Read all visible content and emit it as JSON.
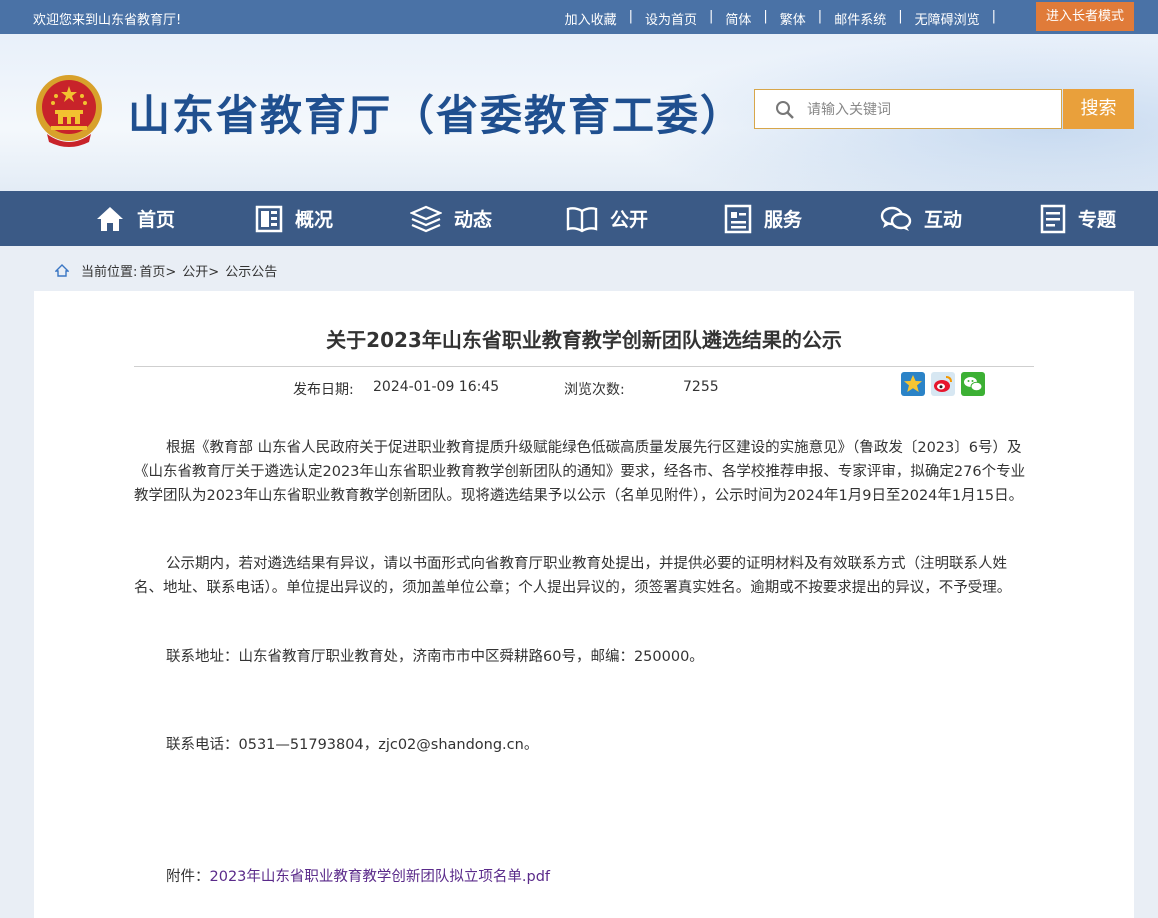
{
  "topbar": {
    "welcome": "欢迎您来到山东省教育厅!",
    "links": [
      "加入收藏",
      "设为首页",
      "简体",
      "繁体",
      "邮件系统",
      "无障碍浏览"
    ],
    "separator": "|",
    "elder_mode": "进入长者模式"
  },
  "header": {
    "site_title": "山东省教育厅（省委教育工委）",
    "search_placeholder": "请输入关键词",
    "search_button": "搜索"
  },
  "nav": {
    "items": [
      "首页",
      "概况",
      "动态",
      "公开",
      "服务",
      "互动",
      "专题"
    ]
  },
  "breadcrumb": {
    "prefix": "当前位置:",
    "items": [
      "首页>",
      "公开>",
      "公示公告"
    ]
  },
  "article": {
    "title": "关于2023年山东省职业教育教学创新团队遴选结果的公示",
    "date_label": "发布日期:",
    "date": "2024-01-09 16:45",
    "views_label": "浏览次数:",
    "views": "7255",
    "para1": "根据《教育部 山东省人民政府关于促进职业教育提质升级赋能绿色低碳高质量发展先行区建设的实施意见》（鲁政发〔2023〕6号）及《山东省教育厅关于遴选认定2023年山东省职业教育教学创新团队的通知》要求，经各市、各学校推荐申报、专家评审，拟确定276个专业教学团队为2023年山东省职业教育教学创新团队。现将遴选结果予以公示（名单见附件），公示时间为2024年1月9日至2024年1月15日。",
    "para2": "公示期内，若对遴选结果有异议，请以书面形式向省教育厅职业教育处提出，并提供必要的证明材料及有效联系方式（注明联系人姓名、地址、联系电话）。单位提出异议的，须加盖单位公章；个人提出异议的，须签署真实姓名。逾期或不按要求提出的异议，不予受理。",
    "address": "联系地址：山东省教育厅职业教育处，济南市市中区舜耕路60号，邮编：250000。",
    "phone": "联系电话：0531—51793804，zjc02@shandong.cn。",
    "attachment_label": "附件：",
    "attachment_link": "2023年山东省职业教育教学创新团队拟立项名单.pdf"
  },
  "colors": {
    "topbar": "#4a72a6",
    "nav": "#3b5a86",
    "title": "#1f4f8f",
    "search_button": "#e9a03b",
    "elder_button": "#e07b39"
  }
}
